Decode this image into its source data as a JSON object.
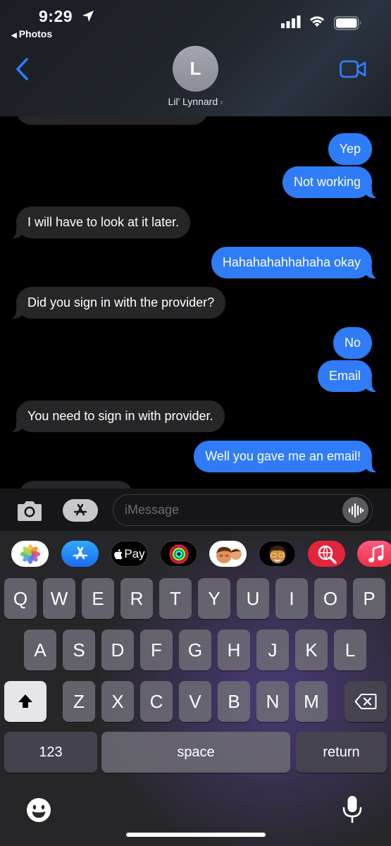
{
  "status_bar": {
    "time": "9:29",
    "back_app": "Photos"
  },
  "header": {
    "avatar_initial": "L",
    "contact_name": "Lil’ Lynnard"
  },
  "messages": [
    {
      "direction": "out",
      "text": "Yep"
    },
    {
      "direction": "out",
      "text": "Not working"
    },
    {
      "direction": "in",
      "text": "I will have to look at it later."
    },
    {
      "direction": "out",
      "text": "Hahahahahhahaha okay"
    },
    {
      "direction": "in",
      "text": "Did you sign in with the provider?"
    },
    {
      "direction": "out",
      "text": "No"
    },
    {
      "direction": "out",
      "text": "Email"
    },
    {
      "direction": "in",
      "text": "You need to sign in with provider."
    },
    {
      "direction": "out",
      "text": "Well you gave me an email!"
    }
  ],
  "input": {
    "placeholder": "iMessage",
    "value": ""
  },
  "app_strip": {
    "apple_pay_label": "Pay"
  },
  "keyboard": {
    "row1": [
      "Q",
      "W",
      "E",
      "R",
      "T",
      "Y",
      "U",
      "I",
      "O",
      "P"
    ],
    "row2": [
      "A",
      "S",
      "D",
      "F",
      "G",
      "H",
      "J",
      "K",
      "L"
    ],
    "row3": [
      "Z",
      "X",
      "C",
      "V",
      "B",
      "N",
      "M"
    ],
    "numbers_label": "123",
    "space_label": "space",
    "return_label": "return"
  },
  "colors": {
    "outgoing_bubble": "#2f7cf6",
    "incoming_bubble": "#262628",
    "accent": "#2f7cf6"
  },
  "icons": [
    "location-arrow-icon",
    "signal-icon",
    "wifi-icon",
    "battery-icon",
    "back-chevron-icon",
    "video-camera-icon",
    "camera-icon",
    "app-store-icon",
    "audio-waveform-icon",
    "photos-icon",
    "apple-pay-icon",
    "activity-icon",
    "memoji-icon",
    "search-web-icon",
    "music-icon",
    "shift-icon",
    "delete-icon",
    "emoji-icon",
    "microphone-icon"
  ]
}
